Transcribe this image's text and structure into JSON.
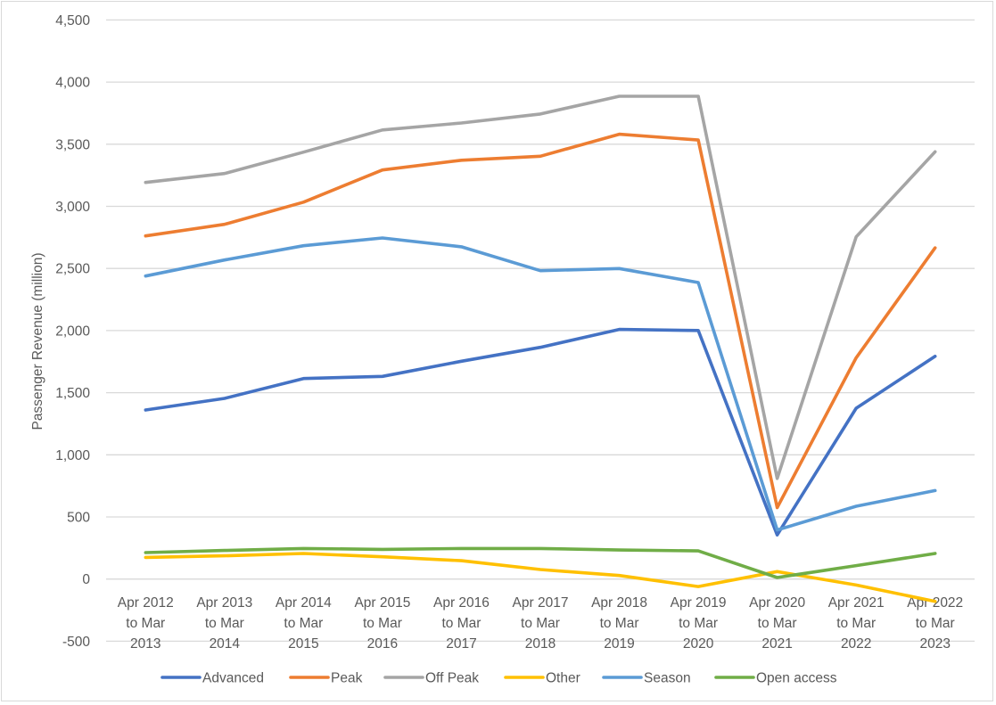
{
  "chart_data": {
    "type": "line",
    "title": "",
    "xlabel": "",
    "ylabel": "Passenger Revenue (million)",
    "ylim": [
      -500,
      4500
    ],
    "yticks": [
      -500,
      0,
      500,
      1000,
      1500,
      2000,
      2500,
      3000,
      3500,
      4000,
      4500
    ],
    "ytick_labels": [
      "-500",
      "0",
      "500",
      "1,000",
      "1,500",
      "2,000",
      "2,500",
      "3,000",
      "3,500",
      "4,000",
      "4,500"
    ],
    "grid": true,
    "legend_position": "bottom",
    "categories": [
      [
        "Apr 2012",
        "to Mar",
        "2013"
      ],
      [
        "Apr 2013",
        "to Mar",
        "2014"
      ],
      [
        "Apr 2014",
        "to Mar",
        "2015"
      ],
      [
        "Apr 2015",
        "to Mar",
        "2016"
      ],
      [
        "Apr 2016",
        "to Mar",
        "2017"
      ],
      [
        "Apr 2017",
        "to Mar",
        "2018"
      ],
      [
        "Apr 2018",
        "to Mar",
        "2019"
      ],
      [
        "Apr 2019",
        "to Mar",
        "2020"
      ],
      [
        "Apr 2020",
        "to Mar",
        "2021"
      ],
      [
        "Apr 2021",
        "to Mar",
        "2022"
      ],
      [
        "Apr 2022",
        "to Mar",
        "2023"
      ]
    ],
    "series": [
      {
        "name": "Advanced",
        "color": "#4472c4",
        "values": [
          1361,
          1454,
          1614,
          1631,
          1753,
          1865,
          2009,
          2001,
          355,
          1375,
          1793
        ]
      },
      {
        "name": "Peak",
        "color": "#ed7d31",
        "values": [
          2762,
          2855,
          3034,
          3293,
          3371,
          3403,
          3580,
          3534,
          575,
          1781,
          2666
        ]
      },
      {
        "name": "Off Peak",
        "color": "#a5a5a5",
        "values": [
          3192,
          3264,
          3436,
          3615,
          3671,
          3743,
          3886,
          3886,
          810,
          2755,
          3439
        ]
      },
      {
        "name": "Other",
        "color": "#ffc000",
        "values": [
          174,
          187,
          206,
          179,
          148,
          77,
          29,
          -60,
          60,
          -48,
          -180
        ]
      },
      {
        "name": "Season",
        "color": "#5b9bd5",
        "values": [
          2439,
          2568,
          2683,
          2745,
          2674,
          2482,
          2499,
          2387,
          395,
          586,
          712
        ]
      },
      {
        "name": "Open access",
        "color": "#70ad47",
        "values": [
          213,
          230,
          246,
          239,
          246,
          246,
          234,
          227,
          12,
          108,
          206
        ]
      }
    ]
  }
}
